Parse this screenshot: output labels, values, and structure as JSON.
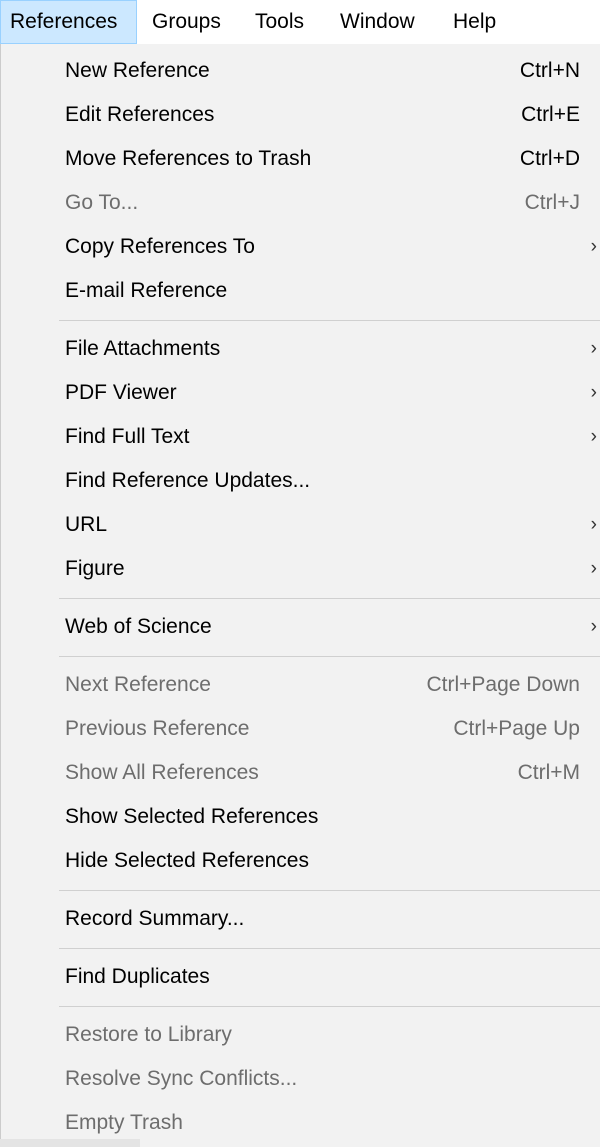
{
  "menubar": {
    "items": [
      {
        "label": "References",
        "active": true
      },
      {
        "label": "Groups"
      },
      {
        "label": "Tools"
      },
      {
        "label": "Window"
      },
      {
        "label": "Help"
      }
    ]
  },
  "menu": {
    "submenu_arrow": "›",
    "items": [
      {
        "label": "New Reference",
        "shortcut": "Ctrl+N",
        "enabled": true
      },
      {
        "label": "Edit References",
        "shortcut": "Ctrl+E",
        "enabled": true
      },
      {
        "label": "Move References to Trash",
        "shortcut": "Ctrl+D",
        "enabled": true
      },
      {
        "label": "Go To...",
        "shortcut": "Ctrl+J",
        "enabled": false
      },
      {
        "label": "Copy References To",
        "submenu": true,
        "enabled": true
      },
      {
        "label": "E-mail Reference",
        "enabled": true
      },
      {
        "label": "File Attachments",
        "submenu": true,
        "enabled": true
      },
      {
        "label": "PDF Viewer",
        "submenu": true,
        "enabled": true
      },
      {
        "label": "Find Full Text",
        "submenu": true,
        "enabled": true
      },
      {
        "label": "Find Reference Updates...",
        "enabled": true
      },
      {
        "label": "URL",
        "submenu": true,
        "enabled": true
      },
      {
        "label": "Figure",
        "submenu": true,
        "enabled": true
      },
      {
        "label": "Web of Science",
        "submenu": true,
        "enabled": true
      },
      {
        "label": "Next Reference",
        "shortcut": "Ctrl+Page Down",
        "enabled": false
      },
      {
        "label": "Previous Reference",
        "shortcut": "Ctrl+Page Up",
        "enabled": false
      },
      {
        "label": "Show All References",
        "shortcut": "Ctrl+M",
        "enabled": false
      },
      {
        "label": "Show Selected References",
        "enabled": true
      },
      {
        "label": "Hide Selected References",
        "enabled": true
      },
      {
        "label": "Record Summary...",
        "enabled": true
      },
      {
        "label": "Find Duplicates",
        "enabled": true
      },
      {
        "label": "Restore to Library",
        "enabled": false
      },
      {
        "label": "Resolve Sync Conflicts...",
        "enabled": false
      },
      {
        "label": "Empty Trash",
        "enabled": false
      }
    ]
  },
  "colors": {
    "menu_background": "#f2f2f2",
    "active_menubar_highlight": "#cce8ff",
    "disabled_text": "#6d6d6d",
    "separator": "#d0d0d0"
  }
}
